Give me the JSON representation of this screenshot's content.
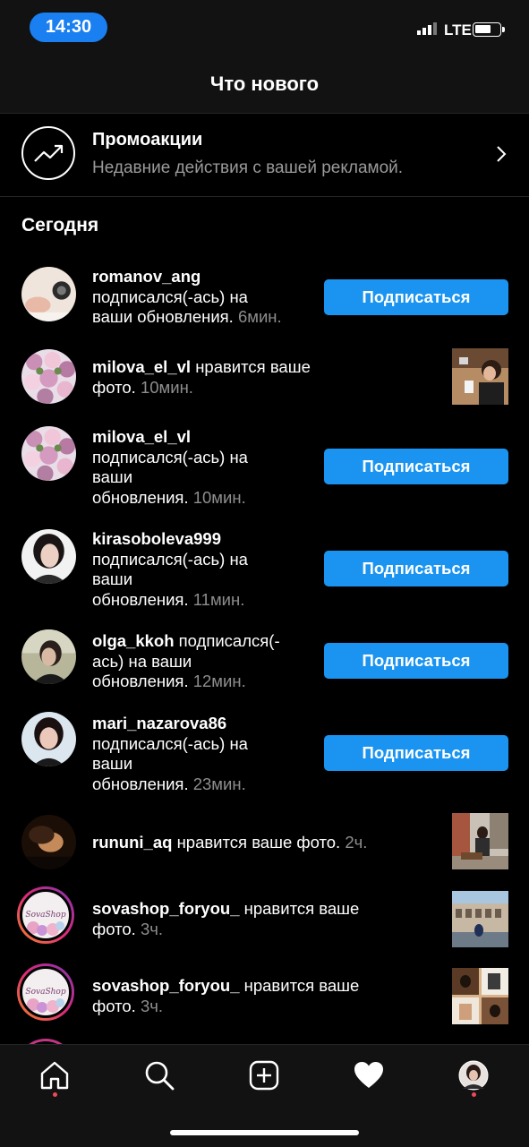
{
  "status_bar": {
    "time": "14:30",
    "network": "LTE"
  },
  "header": {
    "title": "Что нового"
  },
  "promo": {
    "title": "Промоакции",
    "subtitle": "Недавние действия с вашей рекламой."
  },
  "section": {
    "title": "Сегодня"
  },
  "rows": [
    {
      "username": "romanov_ang",
      "text_line1": "подписался(-ась) на",
      "text_line2": "ваши обновления.",
      "time": "6мин.",
      "action": "Подписаться"
    },
    {
      "username": "milova_el_vl",
      "text_line1": "нравится ваше",
      "text_line2": "фото.",
      "time": "10мин."
    },
    {
      "username": "milova_el_vl",
      "text_line1": "подписался(-ась) на",
      "text_line2": "ваши",
      "text_line3": "обновления.",
      "time": "10мин.",
      "action": "Подписаться"
    },
    {
      "username": "kirasoboleva999",
      "text_line1": "подписался(-ась) на",
      "text_line2": "ваши",
      "text_line3": "обновления.",
      "time": "11мин.",
      "action": "Подписаться"
    },
    {
      "username": "olga_kkoh",
      "text_line1": "подписался(-",
      "text_line2": "ась) на ваши",
      "text_line3": "обновления.",
      "time": "12мин.",
      "action": "Подписаться"
    },
    {
      "username": "mari_nazarova86",
      "text_line1": "подписался(-ась) на",
      "text_line2": "ваши",
      "text_line3": "обновления.",
      "time": "23мин.",
      "action": "Подписаться"
    },
    {
      "username": "rununi_aq",
      "text_line1": "нравится ваше фото.",
      "time": "2ч."
    },
    {
      "username": "sovashop_foryou_",
      "text_line1": "нравится ваше",
      "text_line2": "фото.",
      "time": "3ч.",
      "logo": "SovaShop"
    },
    {
      "username": "sovashop_foryou_",
      "text_line1": "нравится ваше",
      "text_line2": "фото.",
      "time": "3ч.",
      "logo": "SovaShop"
    }
  ],
  "tabbar": {
    "items": [
      "home-icon",
      "search-icon",
      "add-post-icon",
      "activity-heart-icon",
      "profile-avatar"
    ],
    "accent": "#ed4956"
  },
  "colors": {
    "primary_button": "#1a94f0",
    "time_pill": "#1a7ff0"
  }
}
